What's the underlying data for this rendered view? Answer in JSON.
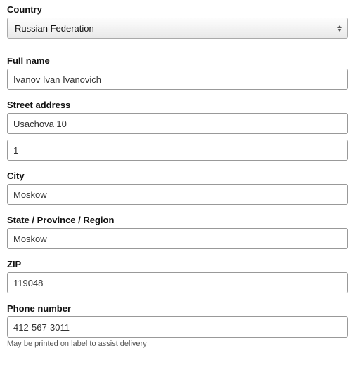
{
  "country": {
    "label": "Country",
    "value": "Russian Federation"
  },
  "full_name": {
    "label": "Full name",
    "value": "Ivanov Ivan Ivanovich"
  },
  "street": {
    "label": "Street address",
    "line1": "Usachova 10",
    "line2": "1"
  },
  "city": {
    "label": "City",
    "value": "Moskow"
  },
  "state": {
    "label": "State / Province / Region",
    "value": "Moskow"
  },
  "zip": {
    "label": "ZIP",
    "value": "119048"
  },
  "phone": {
    "label": "Phone number",
    "value": "412-567-3011",
    "hint": "May be printed on label to assist delivery"
  }
}
